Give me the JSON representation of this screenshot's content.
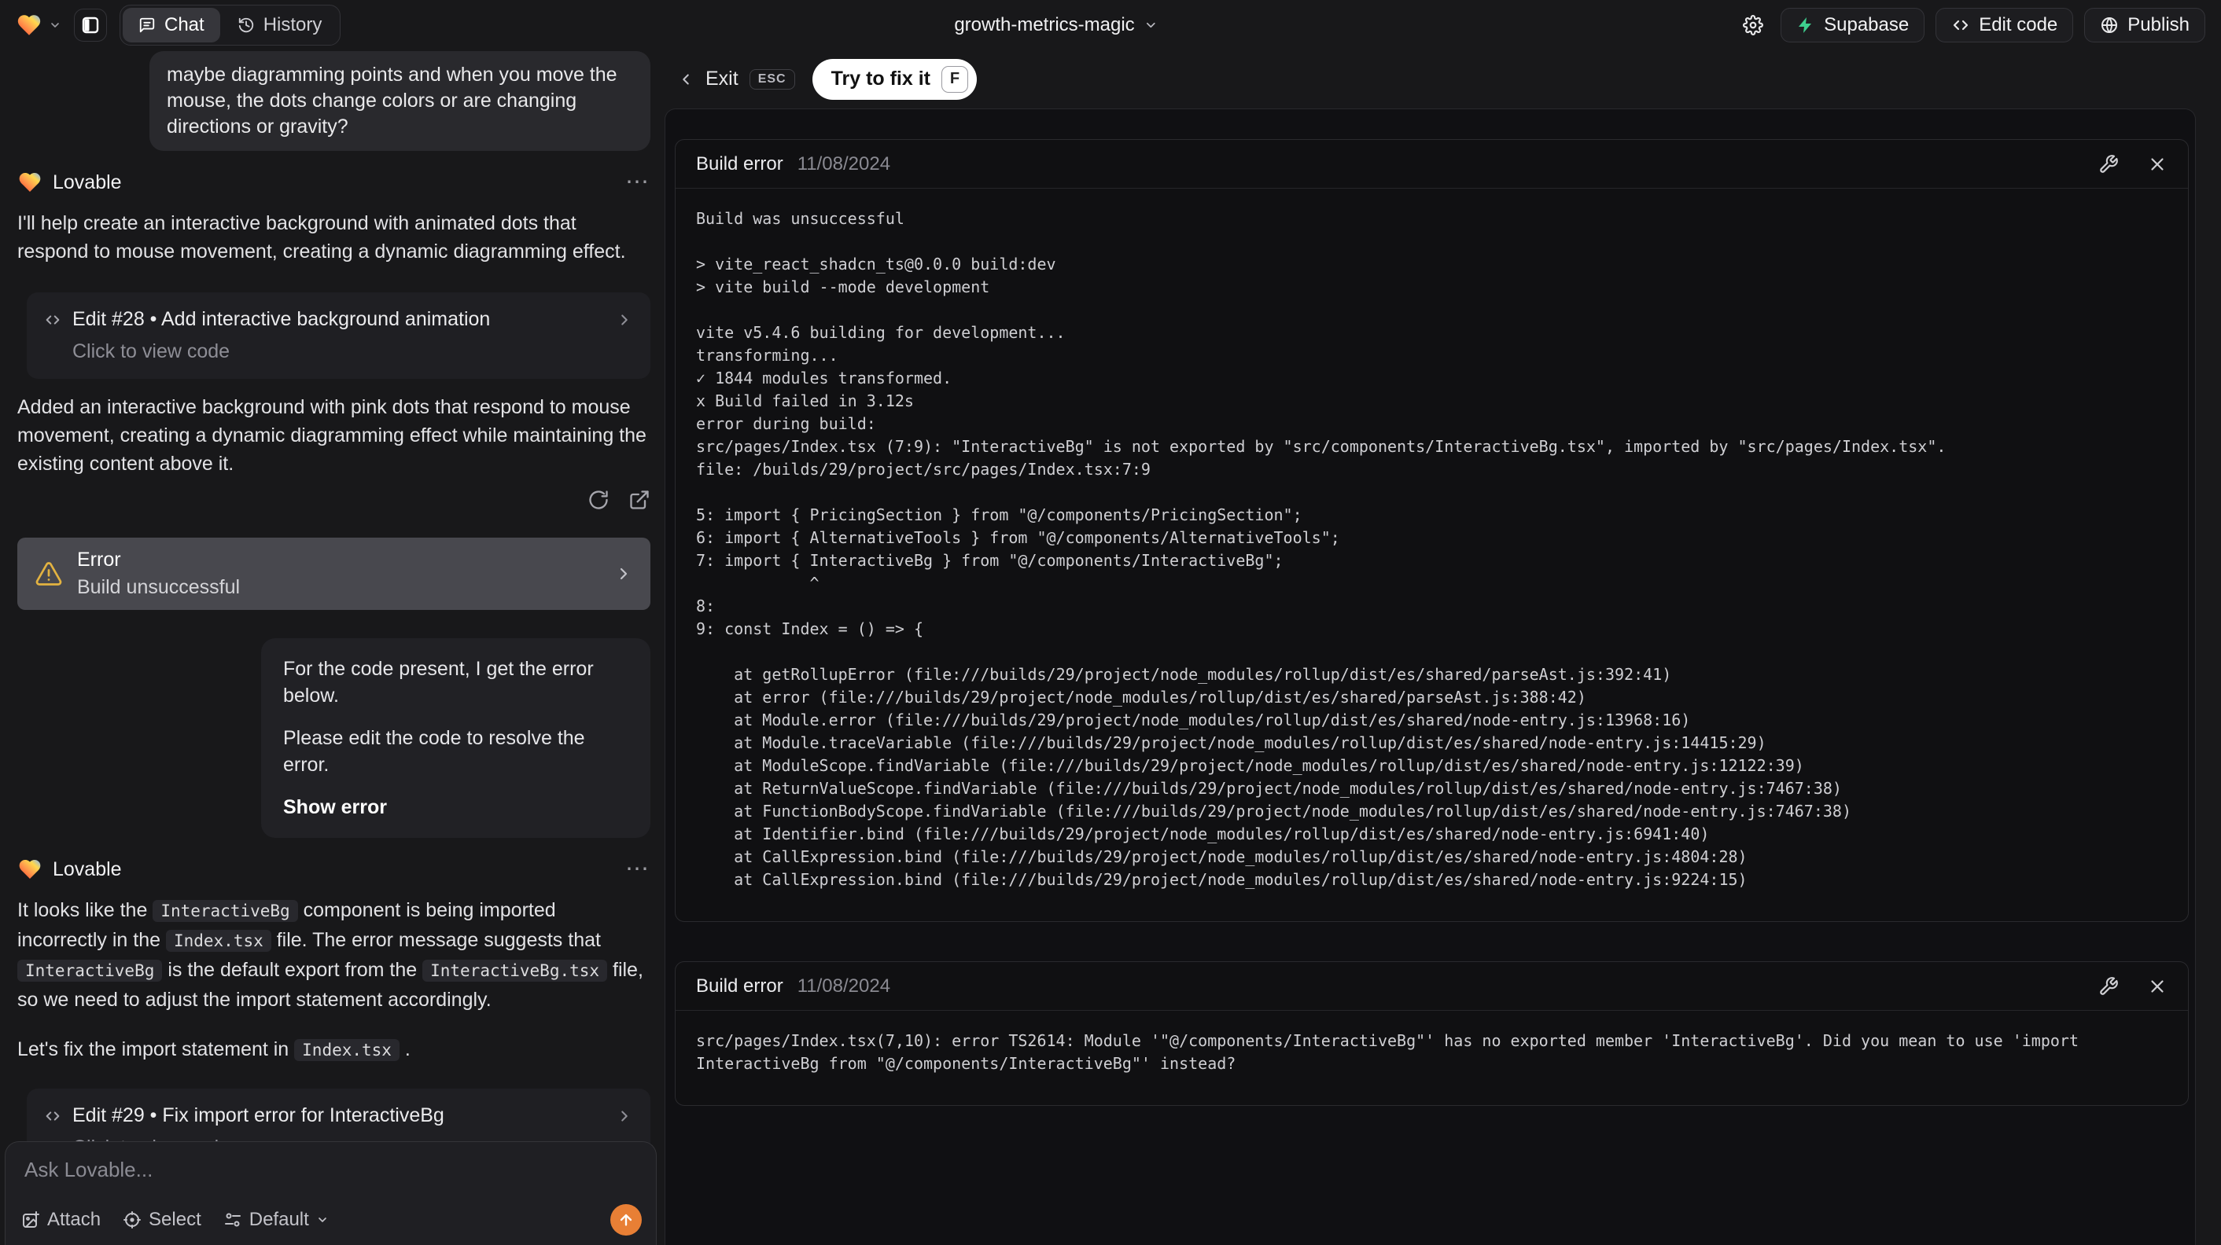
{
  "topbar": {
    "chat_tab": "Chat",
    "history_tab": "History",
    "project_name": "growth-metrics-magic",
    "supabase_label": "Supabase",
    "edit_code_label": "Edit code",
    "publish_label": "Publish"
  },
  "chat": {
    "user_message": "maybe diagramming points and when you move the mouse, the dots change colors or are changing directions or gravity?",
    "assistant_name": "Lovable",
    "msg1_intro": "I'll help create an interactive background with animated dots that respond to mouse movement, creating a dynamic diagramming effect.",
    "edit28": {
      "title": "Edit #28 • Add interactive background animation",
      "subtitle": "Click to view code"
    },
    "msg1_summary": "Added an interactive background with pink dots that respond to mouse movement, creating a dynamic diagramming effect while maintaining the existing content above it.",
    "error_card": {
      "title": "Error",
      "subtitle": "Build unsuccessful"
    },
    "followup": {
      "line1": "For the code present, I get the error below.",
      "line2": "Please edit the code to resolve the error.",
      "action": "Show error"
    },
    "msg2_rich": [
      {
        "text": "It looks like the "
      },
      {
        "code": true,
        "text": "InteractiveBg"
      },
      {
        "text": " component is being imported incorrectly in the "
      },
      {
        "code": true,
        "text": "Index.tsx"
      },
      {
        "text": " file. The error message suggests that "
      },
      {
        "code": true,
        "text": "InteractiveBg"
      },
      {
        "text": " is the default export from the "
      },
      {
        "code": true,
        "text": "InteractiveBg.tsx"
      },
      {
        "text": " file, so we need to adjust the import statement accordingly."
      }
    ],
    "msg2_line2": [
      {
        "text": "Let's fix the import statement in "
      },
      {
        "code": true,
        "text": "Index.tsx"
      },
      {
        "text": " ."
      }
    ],
    "edit29": {
      "title": "Edit #29 • Fix import error for InteractiveBg",
      "subtitle": "Click to view code"
    },
    "composer": {
      "placeholder": "Ask Lovable...",
      "attach_label": "Attach",
      "select_label": "Select",
      "model_label": "Default"
    }
  },
  "workspace": {
    "exit_label": "Exit",
    "esc_key": "ESC",
    "fix_button": "Try to fix it",
    "fix_key": "F",
    "panels": [
      {
        "title": "Build error",
        "date": "11/08/2024",
        "log_lines": [
          "Build was unsuccessful",
          "",
          "> vite_react_shadcn_ts@0.0.0 build:dev",
          "> vite build --mode development",
          "",
          "vite v5.4.6 building for development...",
          "transforming...",
          "✓ 1844 modules transformed.",
          "x Build failed in 3.12s",
          "error during build:",
          "src/pages/Index.tsx (7:9): \"InteractiveBg\" is not exported by \"src/components/InteractiveBg.tsx\", imported by \"src/pages/Index.tsx\".",
          "file: /builds/29/project/src/pages/Index.tsx:7:9",
          "",
          "5: import { PricingSection } from \"@/components/PricingSection\";",
          "6: import { AlternativeTools } from \"@/components/AlternativeTools\";",
          "7: import { InteractiveBg } from \"@/components/InteractiveBg\";",
          "            ^",
          "8:",
          "9: const Index = () => {",
          "",
          "    at getRollupError (file:///builds/29/project/node_modules/rollup/dist/es/shared/parseAst.js:392:41)",
          "    at error (file:///builds/29/project/node_modules/rollup/dist/es/shared/parseAst.js:388:42)",
          "    at Module.error (file:///builds/29/project/node_modules/rollup/dist/es/shared/node-entry.js:13968:16)",
          "    at Module.traceVariable (file:///builds/29/project/node_modules/rollup/dist/es/shared/node-entry.js:14415:29)",
          "    at ModuleScope.findVariable (file:///builds/29/project/node_modules/rollup/dist/es/shared/node-entry.js:12122:39)",
          "    at ReturnValueScope.findVariable (file:///builds/29/project/node_modules/rollup/dist/es/shared/node-entry.js:7467:38)",
          "    at FunctionBodyScope.findVariable (file:///builds/29/project/node_modules/rollup/dist/es/shared/node-entry.js:7467:38)",
          "    at Identifier.bind (file:///builds/29/project/node_modules/rollup/dist/es/shared/node-entry.js:6941:40)",
          "    at CallExpression.bind (file:///builds/29/project/node_modules/rollup/dist/es/shared/node-entry.js:4804:28)",
          "    at CallExpression.bind (file:///builds/29/project/node_modules/rollup/dist/es/shared/node-entry.js:9224:15)"
        ]
      },
      {
        "title": "Build error",
        "date": "11/08/2024",
        "log_lines": [
          "src/pages/Index.tsx(7,10): error TS2614: Module '\"@/components/InteractiveBg\"' has no exported member 'InteractiveBg'. Did you mean to use 'import InteractiveBg from \"@/components/InteractiveBg\"' instead?"
        ]
      }
    ]
  },
  "colors": {
    "accent_orange": "#e87f35",
    "supabase_green": "#3ecf8e",
    "warning_amber": "#e3b341",
    "fix_pill_bg": "#ffffff"
  }
}
